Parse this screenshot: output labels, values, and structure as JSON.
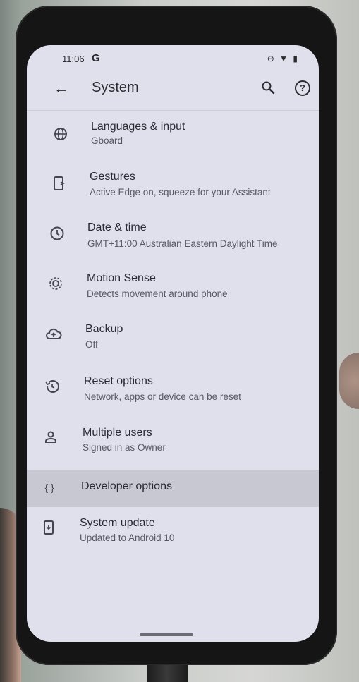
{
  "status": {
    "time": "11:06",
    "g": "G",
    "icons": "⊖ ▼ ▮"
  },
  "appbar": {
    "title": "System"
  },
  "items": [
    {
      "label": "Languages & input",
      "sub": "Gboard"
    },
    {
      "label": "Gestures",
      "sub": "Active Edge on, squeeze for your Assistant"
    },
    {
      "label": "Date & time",
      "sub": "GMT+11:00 Australian Eastern Daylight Time"
    },
    {
      "label": "Motion Sense",
      "sub": "Detects movement around phone"
    },
    {
      "label": "Backup",
      "sub": "Off"
    },
    {
      "label": "Reset options",
      "sub": "Network, apps or device can be reset"
    },
    {
      "label": "Multiple users",
      "sub": "Signed in as Owner"
    },
    {
      "label": "Developer options",
      "sub": ""
    },
    {
      "label": "System update",
      "sub": "Updated to Android 10"
    }
  ],
  "icons": {
    "back": "←",
    "developer": "{ }"
  },
  "colors": {
    "screen_bg": "#dfe0ec",
    "highlight": "#c7c8d2"
  }
}
